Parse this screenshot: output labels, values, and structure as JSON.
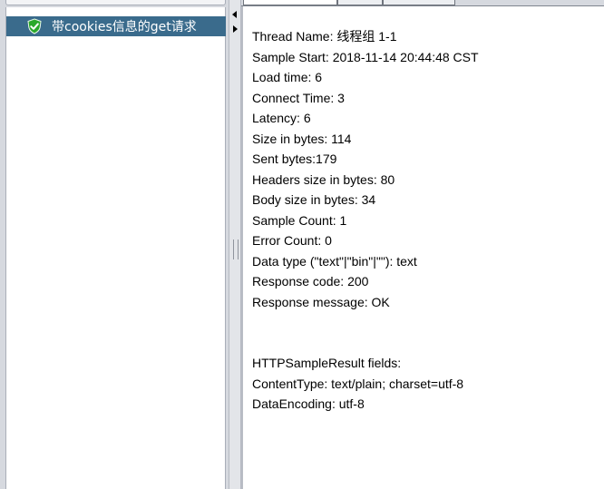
{
  "tree": {
    "items": [
      {
        "label": "带cookies信息的get请求",
        "icon": "shield-check-icon"
      }
    ]
  },
  "colors": {
    "tree_selected_bg": "#3a6b8c",
    "shield_green": "#2aa82a"
  },
  "result": {
    "lines": [
      "Thread Name: 线程组 1-1",
      "Sample Start: 2018-11-14 20:44:48 CST",
      "Load time: 6",
      "Connect Time: 3",
      "Latency: 6",
      "Size in bytes: 114",
      "Sent bytes:179",
      "Headers size in bytes: 80",
      "Body size in bytes: 34",
      "Sample Count: 1",
      "Error Count: 0",
      "Data type (\"text\"|\"bin\"|\"\"): text",
      "Response code: 200",
      "Response message: OK",
      "",
      "",
      "HTTPSampleResult fields:",
      "ContentType: text/plain; charset=utf-8",
      "DataEncoding: utf-8"
    ]
  }
}
